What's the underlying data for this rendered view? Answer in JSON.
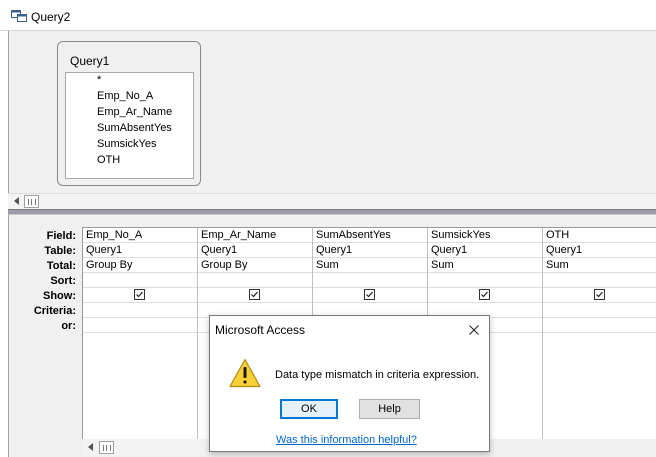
{
  "window": {
    "title": "Query2",
    "icon": "query-icon"
  },
  "table": {
    "name": "Query1",
    "fields": [
      "*",
      "Emp_No_A",
      "Emp_Ar_Name",
      "SumAbsentYes",
      "SumsickYes",
      "OTH"
    ]
  },
  "grid": {
    "row_labels": [
      "Field:",
      "Table:",
      "Total:",
      "Sort:",
      "Show:",
      "Criteria:",
      "or:"
    ],
    "columns": [
      {
        "field": "Emp_No_A",
        "table": "Query1",
        "total": "Group By",
        "sort": "",
        "show": true,
        "criteria": "",
        "or": ""
      },
      {
        "field": "Emp_Ar_Name",
        "table": "Query1",
        "total": "Group By",
        "sort": "",
        "show": true,
        "criteria": "",
        "or": ""
      },
      {
        "field": "SumAbsentYes",
        "table": "Query1",
        "total": "Sum",
        "sort": "",
        "show": true,
        "criteria": "",
        "or": ""
      },
      {
        "field": "SumsickYes",
        "table": "Query1",
        "total": "Sum",
        "sort": "",
        "show": true,
        "criteria": "",
        "or": ""
      },
      {
        "field": "OTH",
        "table": "Query1",
        "total": "Sum",
        "sort": "",
        "show": true,
        "criteria": "",
        "or": ""
      }
    ]
  },
  "dialog": {
    "title": "Microsoft Access",
    "message": "Data type mismatch in criteria expression.",
    "ok_label": "OK",
    "help_label": "Help",
    "link_text": "Was this information helpful?",
    "icon": "warning-icon"
  },
  "colors": {
    "accent": "#0078d7",
    "link": "#0066cc",
    "warning": "#f8d038"
  }
}
